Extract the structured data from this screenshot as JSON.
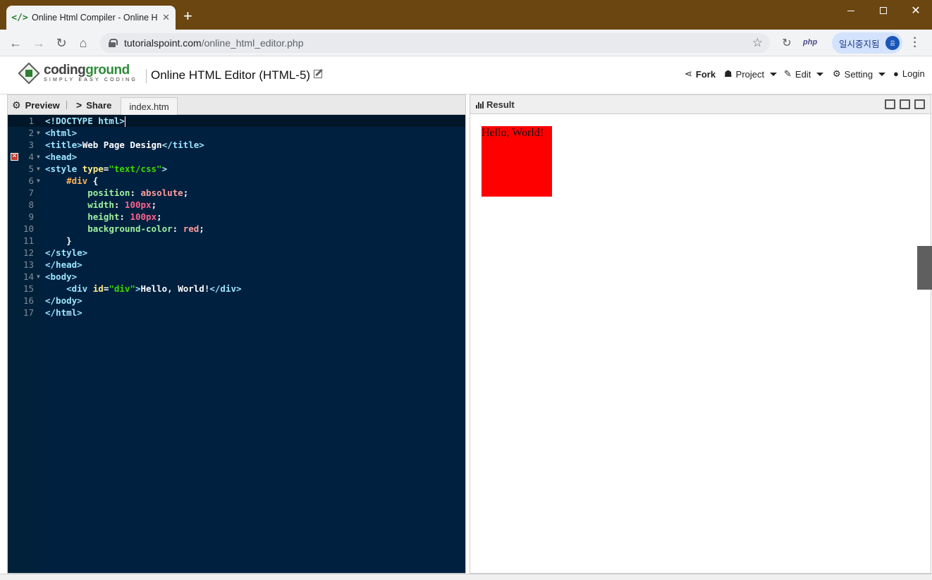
{
  "browser": {
    "tab_title": "Online Html Compiler - Online H",
    "tab_favicon": "</>",
    "new_tab": "+",
    "url_host": "tutorialspoint.com",
    "url_path": "/online_html_editor.php",
    "extension_label": "php",
    "profile_name": "일시중지됨",
    "profile_avatar": "음"
  },
  "site": {
    "logo_main_a": "coding",
    "logo_main_b": "ground",
    "logo_tagline": "SIMPLY EASY CODING",
    "page_title": "Online HTML Editor (HTML-5)",
    "menu": {
      "fork": "Fork",
      "project": "Project",
      "edit": "Edit",
      "setting": "Setting",
      "login": "Login"
    }
  },
  "editor": {
    "preview_label": "Preview",
    "share_label": "Share",
    "file_tab": "index.htm",
    "error_line": 4,
    "line_numbers": [
      "1",
      "2",
      "3",
      "4",
      "5",
      "6",
      "7",
      "8",
      "9",
      "10",
      "11",
      "12",
      "13",
      "14",
      "15",
      "16",
      "17"
    ]
  },
  "result": {
    "title": "Result",
    "output_text": "Hello, World!",
    "box_color": "#ff0000"
  },
  "colors": {
    "titlebar": "#6b4610",
    "editor_bg": "#002040",
    "brand_green": "#2e8b3a"
  }
}
